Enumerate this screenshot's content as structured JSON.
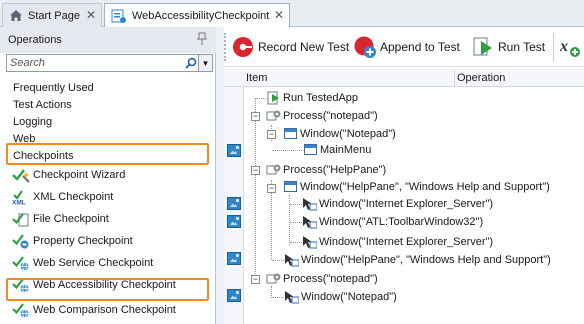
{
  "tabs": [
    {
      "label": "Start Page",
      "icon": "home-icon",
      "close": "✕",
      "active": false
    },
    {
      "label": "WebAccessibilityCheckpoint",
      "icon": "keyword-test-icon",
      "close": "✕",
      "active": true
    }
  ],
  "operations": {
    "title": "Operations",
    "search_placeholder": "Search",
    "categories": [
      "Frequently Used",
      "Test Actions",
      "Logging",
      "Web",
      "Checkpoints"
    ],
    "items": [
      {
        "label": "Checkpoint Wizard",
        "icon": "checkpoint-wizard-icon"
      },
      {
        "label": "XML Checkpoint",
        "icon": "xml-checkpoint-icon"
      },
      {
        "label": "File Checkpoint",
        "icon": "file-checkpoint-icon"
      },
      {
        "label": "Property Checkpoint",
        "icon": "property-checkpoint-icon"
      },
      {
        "label": "Web Service Checkpoint",
        "icon": "web-service-checkpoint-icon"
      },
      {
        "label": "Web Accessibility Checkpoint",
        "icon": "web-accessibility-checkpoint-icon"
      },
      {
        "label": "Web Comparison Checkpoint",
        "icon": "web-comparison-checkpoint-icon"
      }
    ],
    "highlight_color": "#f08a24"
  },
  "toolbar": {
    "record_label": "Record New Test",
    "append_label": "Append to Test",
    "run_label": "Run Test"
  },
  "grid": {
    "col_item": "Item",
    "col_operation": "Operation",
    "rows": [
      {
        "label": "Run TestedApp"
      },
      {
        "label": "Process(\"notepad\")"
      },
      {
        "label": "Window(\"Notepad\")"
      },
      {
        "label": "MainMenu"
      },
      {
        "label": "Process(\"HelpPane\")"
      },
      {
        "label": "Window(\"HelpPane\", \"Windows Help and Support\")"
      },
      {
        "label": "Window(\"Internet Explorer_Server\")"
      },
      {
        "label": "Window(\"ATL:ToolbarWindow32\")"
      },
      {
        "label": "Window(\"Internet Explorer_Server\")"
      },
      {
        "label": "Window(\"HelpPane\", \"Windows Help and Support\")"
      },
      {
        "label": "Process(\"notepad\")"
      },
      {
        "label": "Window(\"Notepad\")"
      }
    ]
  },
  "colors": {
    "accent": "#2f86c9",
    "record_red": "#d9262c",
    "run_green": "#2ea043"
  }
}
